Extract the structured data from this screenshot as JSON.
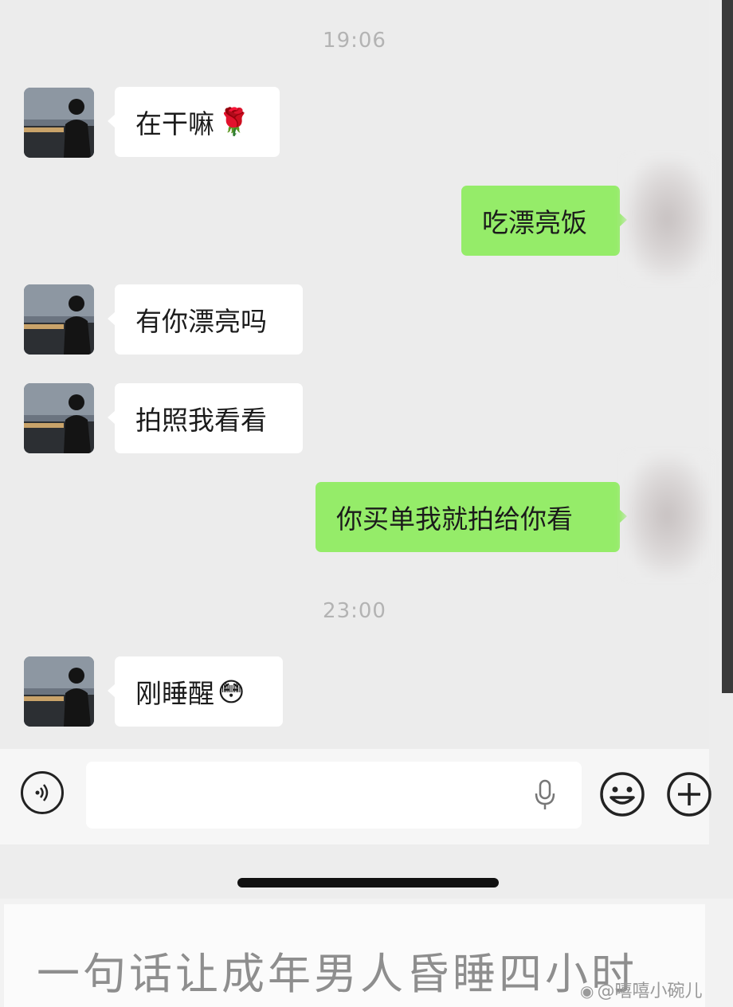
{
  "chat": {
    "timestamps": [
      "19:06",
      "23:00"
    ],
    "messages": [
      {
        "side": "left",
        "text": "在干嘛",
        "emoji": "🌹"
      },
      {
        "side": "right",
        "text": "吃漂亮饭"
      },
      {
        "side": "left",
        "text": "有你漂亮吗"
      },
      {
        "side": "left",
        "text": "拍照我看看"
      },
      {
        "side": "right",
        "text": "你买单我就拍给你看"
      },
      {
        "side": "left",
        "text": "刚睡醒",
        "emoji": "😳"
      }
    ]
  },
  "input_bar": {
    "icons": [
      "voice-toggle-icon",
      "microphone-icon",
      "emoji-icon",
      "plus-icon"
    ]
  },
  "caption": {
    "text": "一句话让成年男人昏睡四小时"
  },
  "watermark": {
    "text": "@嘻嘻小碗儿"
  },
  "colors": {
    "sent_bubble": "#95ec69",
    "received_bubble": "#ffffff",
    "chat_background": "#ececec"
  }
}
